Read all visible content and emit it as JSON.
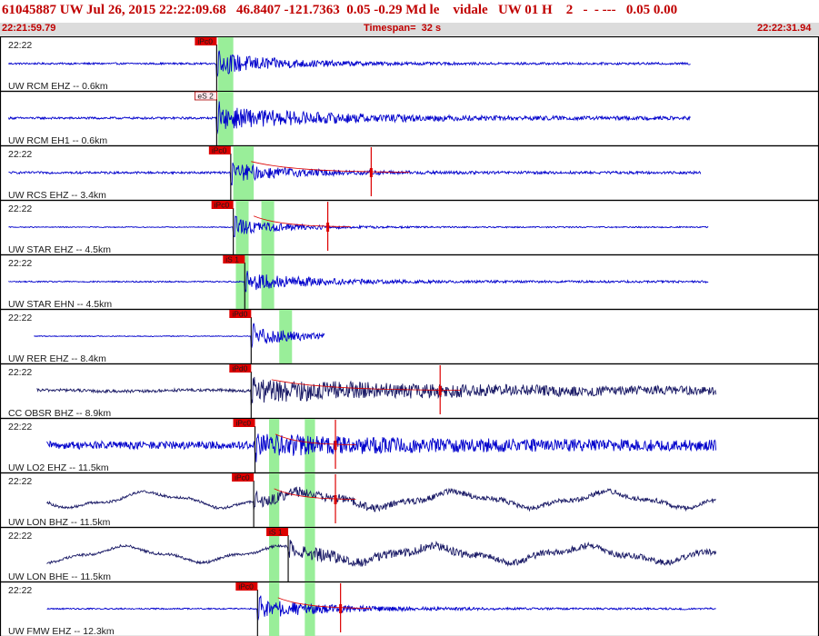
{
  "header": {
    "event_line": "61045887 UW Jul 26, 2015 22:22:09.68   46.8407 -121.7363  0.05 -0.29 Md le    vidale   UW 01 H    2   -  - ---   0.05 0.00",
    "start_time": "22:21:59.79",
    "timespan": "Timespan=  32 s",
    "end_time": "22:22:31.94"
  },
  "colors": {
    "title_red": "#c00000",
    "trace_blue": "#0000cc",
    "trace_navy": "#1a1a66",
    "pick_red": "#dd0000",
    "highlight_green": "#99ee99",
    "panel_border": "#000000"
  },
  "chart_data": {
    "type": "line",
    "title": "Timespan=  32 s",
    "x_range_seconds": [
      0,
      32
    ],
    "panels": [
      {
        "time": "22:22",
        "label": "UW RCM EHZ -- 0.6km",
        "pick": "iPc0",
        "pick_s": 8.45,
        "pick_style": "red",
        "green": [
          8.5,
          9.1
        ],
        "extra_picks": [],
        "end_s": 27.0,
        "color": "blue",
        "style": "burst",
        "amp_pre": 0.04,
        "amp_peak": 0.55,
        "decay": 2.5,
        "long_wave": 0,
        "noise_after": 0.05,
        "coda": null
      },
      {
        "time": "",
        "label": "UW RCM EH1 -- 0.6km",
        "pick": "eS 2",
        "pick_s": 8.45,
        "pick_style": "white",
        "green": [
          8.5,
          9.1
        ],
        "extra_picks": [],
        "end_s": 27.0,
        "color": "blue",
        "style": "burst",
        "amp_pre": 0.05,
        "amp_peak": 0.55,
        "decay": 4.5,
        "long_wave": 0,
        "noise_after": 0.07,
        "coda": null
      },
      {
        "time": "22:22",
        "label": "UW RCS EHZ -- 3.4km",
        "pick": "iPc0",
        "pick_s": 9.0,
        "pick_style": "red",
        "green": [
          9.1,
          9.9
        ],
        "extra_picks": [],
        "end_s": 27.4,
        "color": "blue",
        "style": "burst",
        "amp_pre": 0.05,
        "amp_peak": 0.45,
        "decay": 2.5,
        "long_wave": 0,
        "noise_after": 0.06,
        "coda": {
          "end_s": 16.0,
          "mark_s": 14.5
        }
      },
      {
        "time": "22:22",
        "label": "UW STAR EHZ -- 4.5km",
        "pick": "iPc0",
        "pick_s": 9.1,
        "pick_style": "red",
        "green": [
          9.2,
          9.7,
          10.2,
          10.7
        ],
        "extra_picks": [],
        "end_s": 27.7,
        "color": "blue",
        "style": "burst",
        "amp_pre": 0.02,
        "amp_peak": 0.4,
        "decay": 2.0,
        "long_wave": 0,
        "noise_after": 0.03,
        "coda": {
          "end_s": 13.7,
          "mark_s": 12.8
        }
      },
      {
        "time": "22:22",
        "label": "UW STAR EHN -- 4.5km",
        "pick": "iS 1",
        "pick_s": 9.55,
        "pick_style": "red",
        "green": [
          9.2,
          9.7,
          10.2,
          10.7
        ],
        "extra_picks": [],
        "end_s": 27.7,
        "color": "blue",
        "style": "burst",
        "amp_pre": 0.03,
        "amp_peak": 0.45,
        "decay": 2.5,
        "long_wave": 0,
        "noise_after": 0.05,
        "coda": null
      },
      {
        "time": "22:22",
        "label": "UW RER EHZ -- 8.4km",
        "pick": "iPd0",
        "pick_s": 9.8,
        "pick_style": "red",
        "green": [
          10.9,
          11.4
        ],
        "extra_picks": [],
        "end_s": 12.7,
        "start_s": 1.3,
        "color": "blue",
        "style": "burst",
        "amp_pre": 0.02,
        "amp_peak": 0.45,
        "decay": 2.0,
        "long_wave": 0,
        "noise_after": 0.04,
        "coda": null
      },
      {
        "time": "22:22",
        "label": "CC OBSR BHZ -- 8.9km",
        "pick": "iPd0",
        "pick_s": 9.8,
        "pick_style": "red",
        "green": [],
        "extra_picks": [],
        "end_s": 28.0,
        "start_s": 1.4,
        "color": "navy",
        "style": "noisy",
        "amp_pre": 0.06,
        "amp_peak": 0.5,
        "decay": 8.0,
        "long_wave": 0.03,
        "noise_after": 0.13,
        "coda": {
          "end_s": 18.0,
          "mark_s": 17.2
        }
      },
      {
        "time": "22:22",
        "label": "UW LO2 EHZ -- 11.5km",
        "pick": "iPc0",
        "pick_s": 9.95,
        "pick_style": "red",
        "green": [
          10.5,
          10.9,
          11.9,
          12.3
        ],
        "extra_picks": [],
        "end_s": 28.0,
        "start_s": 1.8,
        "color": "blue",
        "style": "noisy",
        "amp_pre": 0.16,
        "amp_peak": 0.5,
        "decay": 6.0,
        "long_wave": 0,
        "noise_after": 0.22,
        "coda": {
          "end_s": 13.9,
          "mark_s": 13.1
        }
      },
      {
        "time": "22:22",
        "label": "UW LON BHZ -- 11.5km",
        "pick": "iPc0",
        "pick_s": 9.9,
        "pick_style": "red",
        "green": [
          10.5,
          10.9,
          11.9,
          12.3
        ],
        "extra_picks": [],
        "end_s": 28.0,
        "start_s": 1.8,
        "color": "navy",
        "style": "wave",
        "amp_pre": 0.06,
        "amp_peak": 0.3,
        "decay": 4.0,
        "long_wave": 0.3,
        "noise_after": 0.1,
        "coda": {
          "end_s": 13.9,
          "mark_s": 13.1
        }
      },
      {
        "time": "22:22",
        "label": "UW LON BHE -- 11.5km",
        "pick": "iS 1",
        "pick_s": 11.25,
        "pick_style": "red",
        "green": [
          10.5,
          10.9,
          11.9,
          12.3
        ],
        "extra_picks": [],
        "end_s": 28.0,
        "start_s": 1.8,
        "color": "navy",
        "style": "wave",
        "amp_pre": 0.06,
        "amp_peak": 0.35,
        "decay": 4.0,
        "long_wave": 0.3,
        "noise_after": 0.13,
        "coda": null
      },
      {
        "time": "22:22",
        "label": "UW FMW EHZ -- 12.3km",
        "pick": "iPc0",
        "pick_s": 10.05,
        "pick_style": "red",
        "green": [
          10.5,
          10.9,
          11.9,
          12.3
        ],
        "extra_picks": [],
        "end_s": 28.0,
        "start_s": 1.8,
        "color": "blue",
        "style": "burst",
        "amp_pre": 0.03,
        "amp_peak": 0.45,
        "decay": 3.0,
        "long_wave": 0,
        "noise_after": 0.04,
        "coda": {
          "end_s": 14.5,
          "mark_s": 13.3
        }
      }
    ]
  }
}
